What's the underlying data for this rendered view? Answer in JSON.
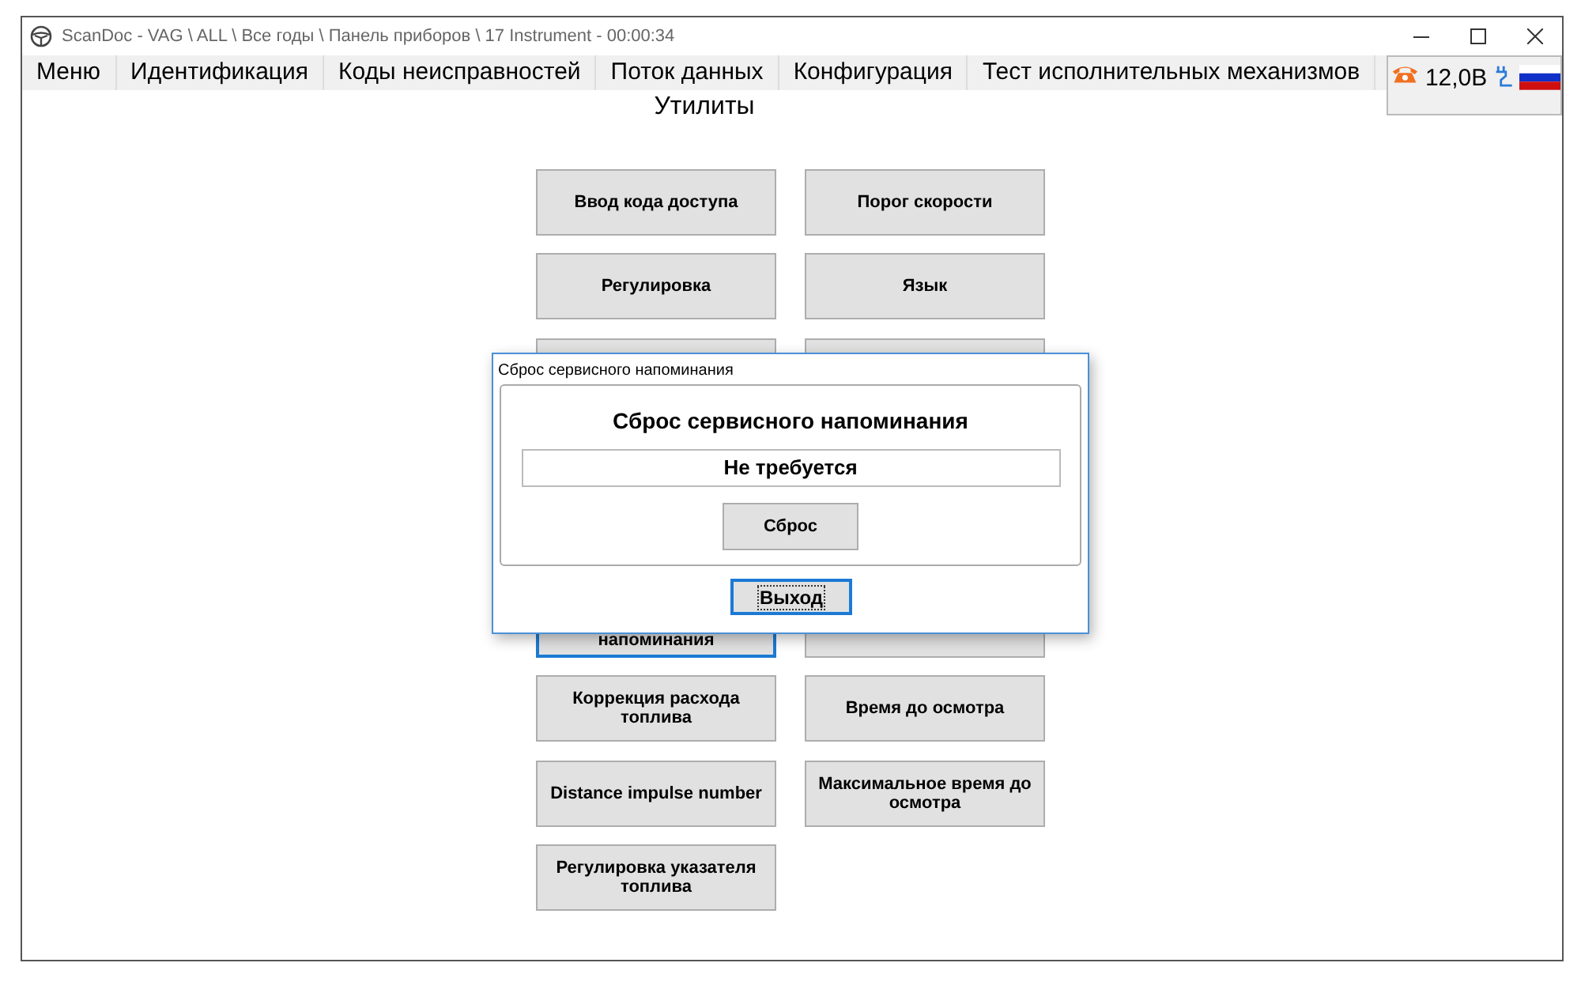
{
  "window": {
    "title": "ScanDoc - VAG \\ ALL \\ Все годы \\ Панель приборов \\ 17 Instrument - 00:00:34"
  },
  "menu": [
    {
      "label": "Меню"
    },
    {
      "label": "Идентификация"
    },
    {
      "label": "Коды неисправностей"
    },
    {
      "label": "Поток данных"
    },
    {
      "label": "Конфигурация"
    },
    {
      "label": "Тест исполнительных механизмов"
    }
  ],
  "status_panel": {
    "voltage": "12,0В"
  },
  "page_title": "Утилиты",
  "upper_buttons": [
    {
      "label": "Ввод кода доступа",
      "focused": false
    },
    {
      "label": "Порог скорости",
      "focused": false
    },
    {
      "label": "Регулировка",
      "focused": false
    },
    {
      "label": "Язык",
      "focused": false
    },
    {
      "focused": false
    },
    {
      "focused": false
    }
  ],
  "lower_buttons": [
    {
      "label": "напоминания",
      "focused": true
    },
    {
      "focused": false
    },
    {
      "label": "Коррекция расхода топлива",
      "focused": false
    },
    {
      "label": "Время до осмотра",
      "focused": false
    },
    {
      "label": "Distance impulse number",
      "focused": false
    },
    {
      "label": "Максимальное время до осмотра",
      "focused": false
    },
    {
      "label": "Регулировка указателя топлива",
      "focused": false
    }
  ],
  "dialog": {
    "title": "Сброс сервисного напоминания",
    "heading": "Сброс сервисного напоминания",
    "value": "Не требуется",
    "reset_button": "Сброс",
    "exit_button": {
      "label": "Выход",
      "focused": true
    }
  }
}
